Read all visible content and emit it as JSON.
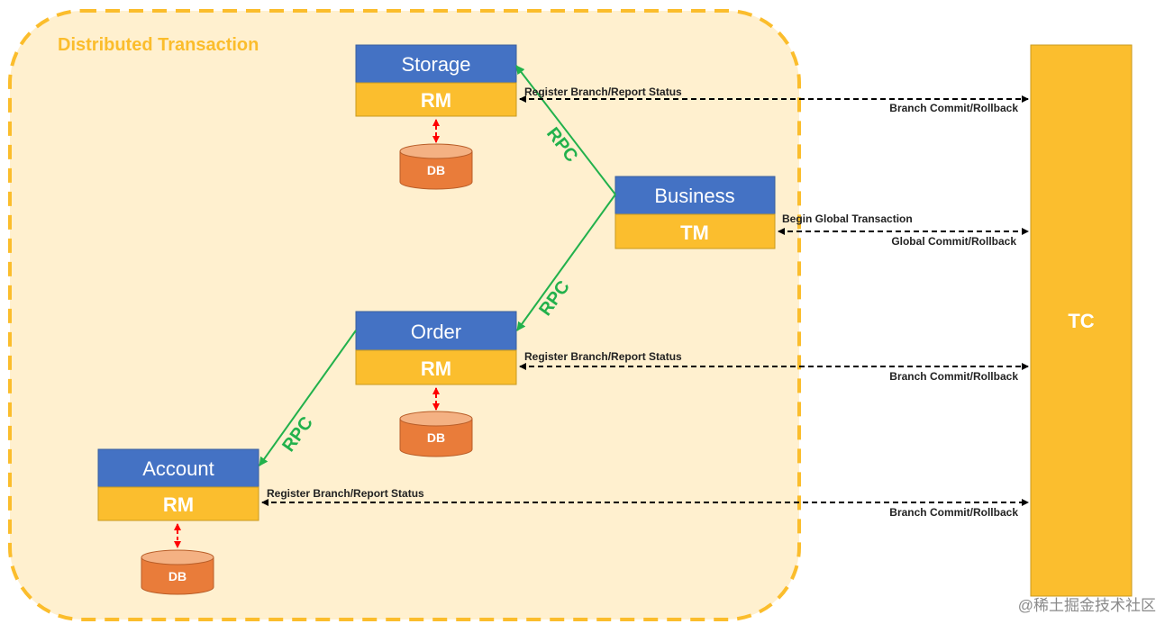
{
  "colors": {
    "region_fill": "#fff0cf",
    "region_border": "#fbbd2c",
    "region_title": "#fbbd2c",
    "service_blue": "#4472c4",
    "role_yellow": "#fbbe2e",
    "db_orange": "#e97c3a",
    "db_top": "#f4b183",
    "rpc_green": "#22b14c",
    "db_link_red": "#ff0000",
    "message_black": "#000000"
  },
  "region": {
    "title": "Distributed Transaction"
  },
  "nodes": {
    "storage": {
      "service": "Storage",
      "role": "RM",
      "db": "DB"
    },
    "business": {
      "service": "Business",
      "role": "TM"
    },
    "order": {
      "service": "Order",
      "role": "RM",
      "db": "DB"
    },
    "account": {
      "service": "Account",
      "role": "RM",
      "db": "DB"
    },
    "tc": {
      "label": "TC"
    }
  },
  "rpc": {
    "label": "RPC"
  },
  "messages": {
    "storage": {
      "upper": "Register Branch/Report Status",
      "lower": "Branch Commit/Rollback"
    },
    "business": {
      "upper": "Begin Global Transaction",
      "lower": "Global Commit/Rollback"
    },
    "order": {
      "upper": "Register Branch/Report Status",
      "lower": "Branch Commit/Rollback"
    },
    "account": {
      "upper": "Register Branch/Report Status",
      "lower": "Branch Commit/Rollback"
    }
  },
  "watermark": "@稀土掘金技术社区"
}
